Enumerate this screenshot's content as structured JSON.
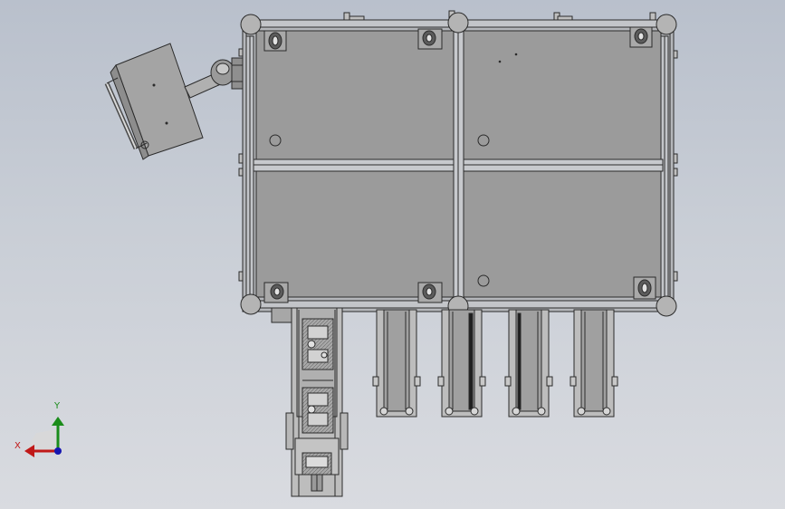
{
  "view": {
    "background_top": "#b9c0cc",
    "background_bottom": "#d9dbe0",
    "part_fill": "#9b9b9b",
    "frame_fill": "#b7b9bd",
    "line_color": "#2b2b2b"
  },
  "triad": {
    "y_label": "Y",
    "x_label": "X",
    "y_color": "#1a8c1a",
    "x_color": "#c01818",
    "z_color": "#1515b0"
  },
  "model": {
    "top_panels": 4,
    "corner_posts": 6,
    "casters": 6,
    "side_conveyors": 4,
    "slide_modules": 2
  }
}
